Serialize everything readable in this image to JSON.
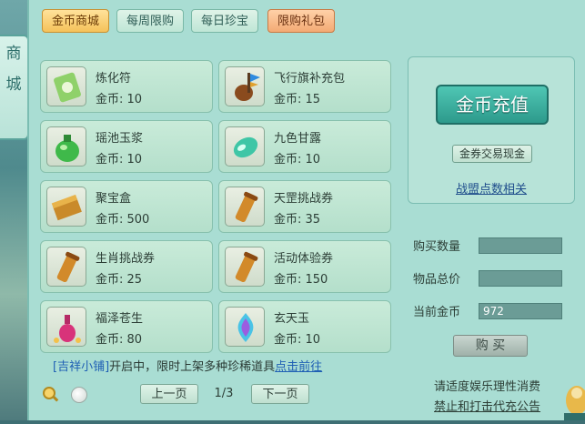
{
  "side_tab": {
    "line1": "商",
    "line2": "城"
  },
  "tabs": [
    {
      "label": "金币商城",
      "state": "active"
    },
    {
      "label": "每周限购",
      "state": "normal"
    },
    {
      "label": "每日珍宝",
      "state": "normal"
    },
    {
      "label": "限购礼包",
      "state": "limited"
    }
  ],
  "items": [
    {
      "name": "炼化符",
      "price": "金币: 10",
      "icon": "talisman-icon"
    },
    {
      "name": "飞行旗补充包",
      "price": "金币: 15",
      "icon": "flag-pack-icon"
    },
    {
      "name": "瑶池玉浆",
      "price": "金币: 10",
      "icon": "jade-potion-icon"
    },
    {
      "name": "九色甘露",
      "price": "金币: 10",
      "icon": "nectar-icon"
    },
    {
      "name": "聚宝盒",
      "price": "金币: 500",
      "icon": "treasure-box-icon"
    },
    {
      "name": "天罡挑战券",
      "price": "金币: 35",
      "icon": "scroll-icon"
    },
    {
      "name": "生肖挑战券",
      "price": "金币: 25",
      "icon": "scroll-icon"
    },
    {
      "name": "活动体验券",
      "price": "金币: 150",
      "icon": "scroll-icon"
    },
    {
      "name": "福泽苍生",
      "price": "金币: 80",
      "icon": "lucky-vase-icon"
    },
    {
      "name": "玄天玉",
      "price": "金币: 10",
      "icon": "mystic-jade-icon"
    }
  ],
  "notice": {
    "shop": "[吉祥小铺]",
    "text": "开启中，限时上架多种珍稀道具",
    "link": "点击前往"
  },
  "pager": {
    "prev": "上一页",
    "page": "1/3",
    "next": "下一页"
  },
  "right": {
    "recharge": "金币充值",
    "exchange": "金券交易现金",
    "league": "战盟点数相关",
    "qty_label": "购买数量",
    "total_label": "物品总价",
    "coins_label": "当前金币",
    "qty_value": "",
    "total_value": "",
    "coins_value": "972",
    "buy": "购 买"
  },
  "footer": {
    "line1": "请适度娱乐理性消费",
    "line2": "禁止和打击代充公告"
  },
  "colors": {
    "panel": "#a9ddd3",
    "accent": "#2d9a8c",
    "link": "#1f5fb4"
  }
}
